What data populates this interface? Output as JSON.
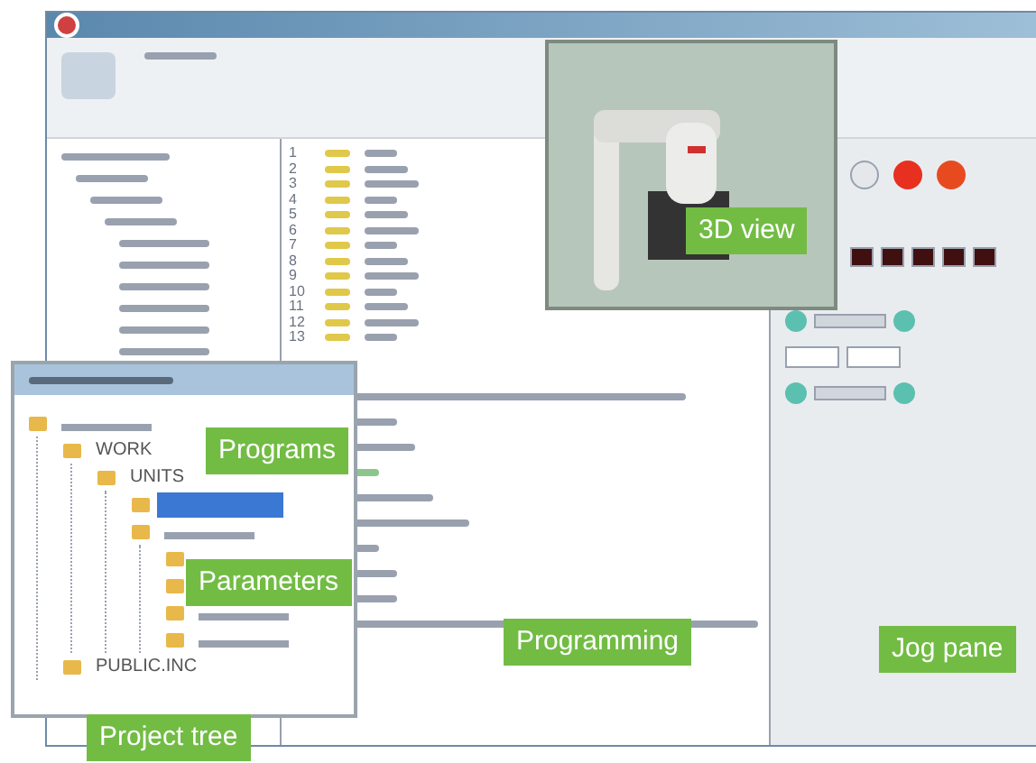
{
  "editor": {
    "line_numbers": [
      "1",
      "2",
      "3",
      "4",
      "5",
      "6",
      "7",
      "8",
      "9",
      "10",
      "11",
      "12",
      "13"
    ]
  },
  "project_tree": {
    "nodes": [
      {
        "selected": false,
        "children": [
          {
            "label": "WORK",
            "selected": false,
            "children": [
              {
                "label": "UNITS",
                "selected": false,
                "children": [
                  {
                    "selected": true
                  },
                  {
                    "selected": false,
                    "children": [
                      {
                        "selected": false
                      },
                      {
                        "selected": false
                      },
                      {
                        "selected": false
                      },
                      {
                        "selected": false
                      }
                    ]
                  }
                ]
              }
            ]
          },
          {
            "label": "PUBLIC.INC",
            "selected": false
          }
        ]
      }
    ]
  },
  "callouts": [
    {
      "text": "3D view"
    },
    {
      "text": "Programs"
    },
    {
      "text": "Parameters"
    },
    {
      "text": "Programming"
    },
    {
      "text": "Jog pane"
    },
    {
      "text": "Project tree"
    }
  ]
}
